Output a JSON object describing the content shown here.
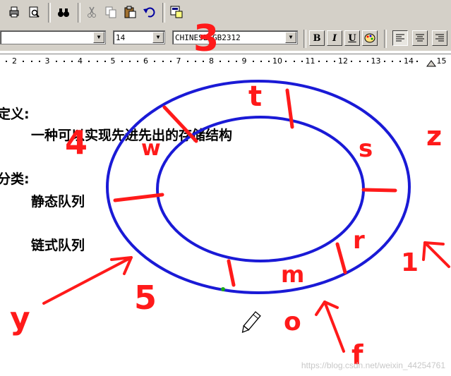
{
  "format_bar": {
    "font_size": "14",
    "font_name": "CHINESE_GB2312",
    "bold_label": "B",
    "italic_label": "I",
    "underline_label": "U"
  },
  "ruler": {
    "numbers": [
      "2",
      "3",
      "4",
      "5",
      "6",
      "7",
      "8",
      "9",
      "10",
      "11",
      "12",
      "13",
      "14",
      "15"
    ]
  },
  "document": {
    "def_heading": "定义:",
    "def_text": "一种可以实现先进先出的存储结构",
    "cat_heading": "分类:",
    "item1": "静态队列",
    "item2": "链式队列"
  },
  "annotations": {
    "labels": [
      "t",
      "s",
      "z",
      "4",
      "w",
      "r",
      "m",
      "1",
      "o",
      "f",
      "y",
      "5",
      "3"
    ]
  },
  "watermark": "https://blog.csdn.net/weixin_44254761",
  "colors": {
    "ink_red": "#ff1a1a",
    "ring_blue": "#1a1ad6",
    "toolbar": "#d4d0c8"
  }
}
